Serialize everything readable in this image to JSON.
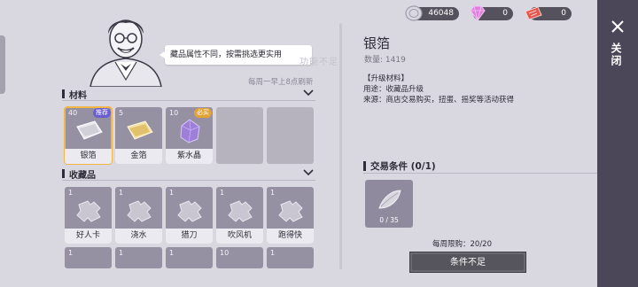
{
  "shop": {
    "speech": "藏品属性不同，按需挑选更实用",
    "ghost_text": "功能不足",
    "refresh_note": "每周一早上8点刷新"
  },
  "currencies": [
    {
      "icon": "silver-coin-icon",
      "value": "46048"
    },
    {
      "icon": "pink-gem-icon",
      "value": "0"
    },
    {
      "icon": "red-ticket-icon",
      "value": "0"
    }
  ],
  "materials": {
    "title": "材料",
    "items": [
      {
        "qty": "40",
        "tag": "推荐",
        "label": "银箔",
        "icon": "silver-foil-icon"
      },
      {
        "qty": "5",
        "tag": "",
        "label": "金箔",
        "icon": "gold-foil-icon"
      },
      {
        "qty": "10",
        "tag": "必买",
        "label": "紫水晶",
        "icon": "amethyst-icon"
      }
    ]
  },
  "collectibles": {
    "title": "收藏品",
    "items": [
      {
        "qty": "1",
        "label": "好人卡",
        "icon": "puzzle-piece-icon"
      },
      {
        "qty": "1",
        "label": "浇水",
        "icon": "puzzle-piece-icon"
      },
      {
        "qty": "1",
        "label": "猎刀",
        "icon": "puzzle-piece-icon"
      },
      {
        "qty": "1",
        "label": "吹风机",
        "icon": "puzzle-piece-icon"
      },
      {
        "qty": "1",
        "label": "跑得快",
        "icon": "puzzle-piece-icon"
      }
    ],
    "row2": [
      {
        "qty": "1"
      },
      {
        "qty": "1"
      },
      {
        "qty": "1"
      },
      {
        "qty": "10"
      },
      {
        "qty": "1"
      }
    ]
  },
  "detail": {
    "title": "银箔",
    "quantity": "数量: 1419",
    "section_label": "【升级材料】",
    "usage": "用途：收藏品升级",
    "source": "来源：商店交易购买，扭蛋、摇奖等活动获得",
    "trade_title": "交易条件 (0/1)",
    "req_count": "0 / 35",
    "weekly_limit": "每周限购：20/20",
    "button": "条件不足"
  },
  "close": {
    "label": "关闭"
  },
  "colors": {
    "accent_selected": "#f1b646",
    "tag_recommend": "#6b5fcf",
    "tag_must_buy": "#e2a334"
  }
}
